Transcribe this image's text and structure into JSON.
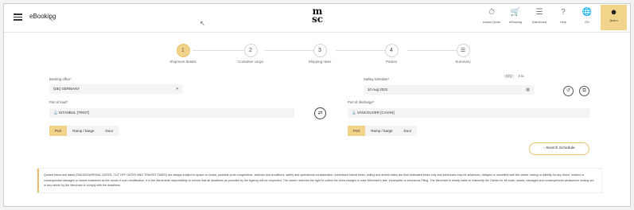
{
  "header": {
    "app_title": "eBooking",
    "logo_top": "m",
    "logo_bottom": "sc",
    "nav": [
      {
        "label": "Instant Quote",
        "icon": "stopwatch-icon",
        "glyph": "⏱"
      },
      {
        "label": "eBooking",
        "icon": "cart-icon",
        "glyph": "🛒"
      },
      {
        "label": "Dashboard",
        "icon": "dashboard-icon",
        "glyph": "☰"
      },
      {
        "label": "Help",
        "icon": "help-icon",
        "glyph": "?"
      },
      {
        "label": "EN",
        "icon": "globe-icon",
        "glyph": "🌐"
      }
    ],
    "user_label": "Quero"
  },
  "steps": [
    {
      "num": "1",
      "label": "Shipment details",
      "active": true
    },
    {
      "num": "2",
      "label": "Container cargo",
      "active": false
    },
    {
      "num": "3",
      "label": "Shipping rates",
      "active": false
    },
    {
      "num": "4",
      "label": "Parties",
      "active": false
    },
    {
      "num": "",
      "label": "Summary",
      "active": false
    }
  ],
  "form": {
    "booking_office_label": "Booking office*",
    "booking_office_value": "(DE) GERMANY",
    "sailing_schedule_label": "Sailing schedule*",
    "sailing_schedule_value": "10 Aug 2022",
    "etd": "ETD",
    "eta": "ETA",
    "pol_label": "Port of load*",
    "pol_value": "ISTANBUL [TRIST]",
    "pod_label": "Port of discharge*",
    "pod_value": "VANCOUVER [CAVAN]",
    "load_modes": [
      "Port",
      "Ramp / barge",
      "Door"
    ],
    "discharge_modes": [
      "Port",
      "Ramp / barge",
      "Door"
    ],
    "search_label": "› Search Schedule"
  },
  "notice": "Quoted times and dates (SAILING/ARRIVAL DATES, CUT OFF DATES AND TRANSIT TIMES) are always subject to space on board, possible ports congestions, adverse sea conditions, safety and operational consideration. Advertised transit times, sailing and arrival dates are thus estimated times only and schedules may be advanced, delayed or cancelled with the carrier having no liability for any direct, indirect or consequential damages or losses sustained as the result of such modification. It is the Merchants responsibility to ensure that all deadlines as provided by the Agency will be respected. The carrier reserves the right to collect the extra charges in case Merchant's late, incomplete or erroneous Filing. The Merchant is strictly liable to indemnify the Carrier for all costs, losses, damages and consequences whatsoever arising out of any failure by the Merchant to comply with the deadlines."
}
